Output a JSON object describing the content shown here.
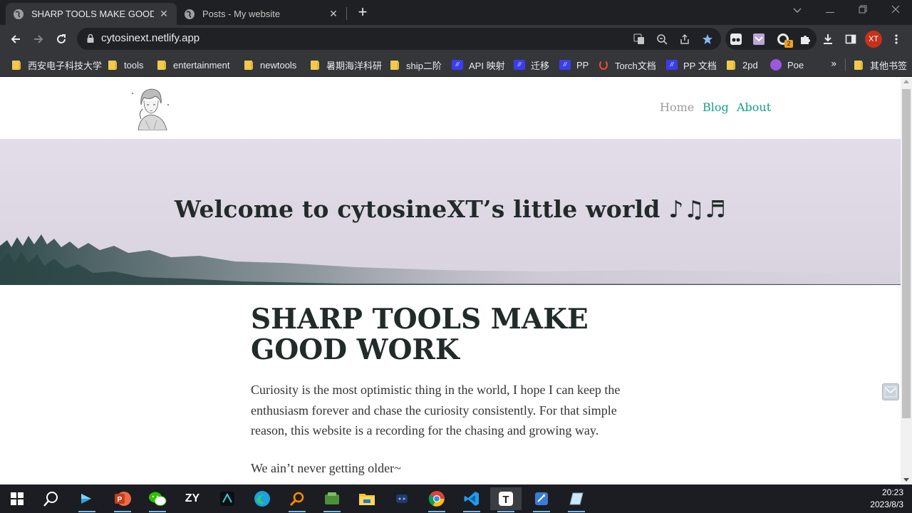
{
  "browser": {
    "tabs": [
      {
        "title": "SHARP TOOLS MAKE GOOD W",
        "active": true
      },
      {
        "title": "Posts - My website",
        "active": false
      }
    ],
    "url": "cytosinext.netlify.app",
    "profile_initials": "XT",
    "extension_badge": "2",
    "bookmarks": [
      {
        "label": "西安电子科技大学",
        "icon": "folder-icon"
      },
      {
        "label": "tools",
        "icon": "folder-icon"
      },
      {
        "label": "entertainment",
        "icon": "folder-icon"
      },
      {
        "label": "newtools",
        "icon": "folder-icon"
      },
      {
        "label": "暑期海洋科研",
        "icon": "folder-icon"
      },
      {
        "label": "ship二阶",
        "icon": "folder-icon"
      },
      {
        "label": "API 映射",
        "icon": "paddle-icon"
      },
      {
        "label": "迁移",
        "icon": "paddle-icon"
      },
      {
        "label": "PP",
        "icon": "paddle-icon"
      },
      {
        "label": "Torch文档",
        "icon": "pytorch-icon"
      },
      {
        "label": "PP 文档",
        "icon": "paddle-icon"
      },
      {
        "label": "2pd",
        "icon": "folder-icon"
      },
      {
        "label": "Poe",
        "icon": "poe-icon"
      }
    ],
    "other_bookmarks": "其他书签"
  },
  "site": {
    "nav": {
      "home": "Home",
      "blog": "Blog",
      "about": "About"
    },
    "hero_title": "Welcome to cytosineXT’s little world ♪♫♬",
    "post_title": "SHARP TOOLS MAKE GOOD WORK",
    "post_body": "Curiosity is the most optimistic thing in the world, I hope I can keep the enthusiasm forever and chase the curiosity consistently. For that simple reason, this website is a recording for the chasing and growing way.",
    "post_tail": "We ain’t never getting older~"
  },
  "taskbar": {
    "time": "20:23",
    "date": "2023/8/3",
    "zy_label": "ZY"
  },
  "colors": {
    "accent": "#11a085",
    "nav_muted": "#9b9b9b",
    "hero_bg": "#e2dde8",
    "heading": "#222a2a"
  }
}
